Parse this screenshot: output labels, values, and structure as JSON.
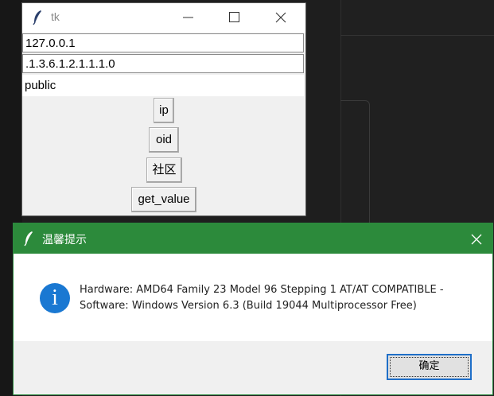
{
  "tk_window": {
    "title": "tk",
    "entries": [
      {
        "value": "127.0.0.1"
      },
      {
        "value": ".1.3.6.1.2.1.1.1.0"
      },
      {
        "value": "public"
      }
    ],
    "buttons": [
      {
        "label": "ip"
      },
      {
        "label": "oid"
      },
      {
        "label": "社区"
      },
      {
        "label": "get_value"
      }
    ]
  },
  "message_box": {
    "title": "温馨提示",
    "icon": "info-icon",
    "icon_glyph": "i",
    "lines": [
      "Hardware: AMD64 Family 23 Model 96 Stepping 1 AT/AT COMPATIBLE -",
      "Software: Windows Version 6.3 (Build 19044 Multiprocessor Free)"
    ],
    "ok_label": "确定",
    "accent_color": "#2c8a3b"
  }
}
